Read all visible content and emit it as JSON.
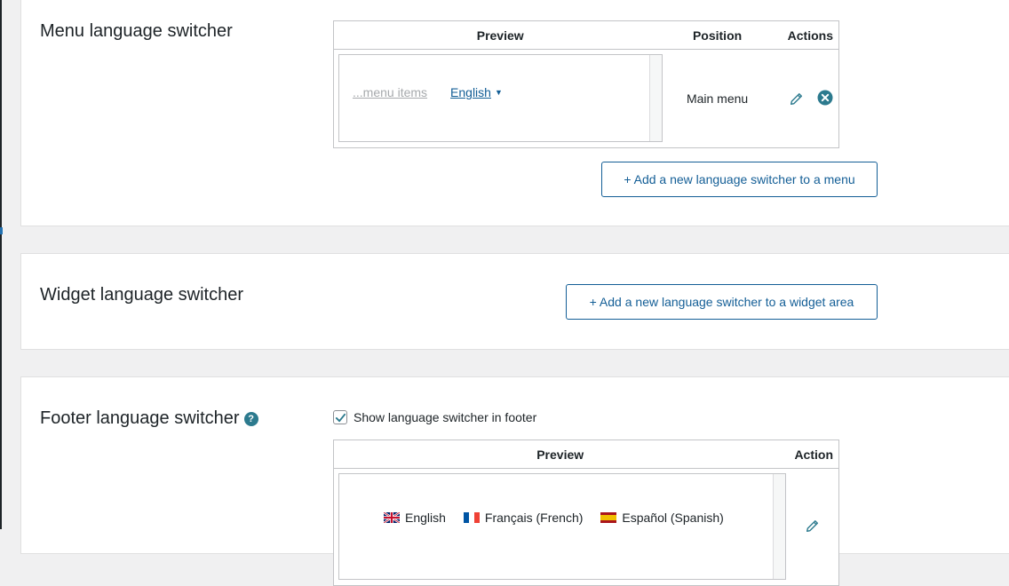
{
  "menu_section": {
    "title": "Menu language switcher",
    "table": {
      "headers": {
        "preview": "Preview",
        "position": "Position",
        "actions": "Actions"
      },
      "row": {
        "menu_items_label": "...menu items",
        "current_language": "English",
        "position": "Main menu"
      }
    },
    "add_button": "+ Add a new language switcher to a menu"
  },
  "widget_section": {
    "title": "Widget language switcher",
    "add_button": "+ Add a new language switcher to a widget area"
  },
  "footer_section": {
    "title": "Footer language switcher",
    "help_symbol": "?",
    "checkbox": {
      "label": "Show language switcher in footer",
      "checked": true
    },
    "table": {
      "headers": {
        "preview": "Preview",
        "action": "Action"
      },
      "languages": [
        {
          "label": "English",
          "flag": "gb-flag"
        },
        {
          "label": "Français (French)",
          "flag": "fr-flag"
        },
        {
          "label": "Español (Spanish)",
          "flag": "es-flag"
        }
      ]
    }
  },
  "colors": {
    "accent": "#135e96",
    "icon_teal": "#2c7a8e",
    "background": "#f0f0f1",
    "border": "#c3c4c7"
  },
  "icons": {
    "edit": "pencil-icon",
    "delete": "close-circle-icon",
    "help": "help-icon",
    "check": "checkmark-icon",
    "dropdown": "caret-down-icon"
  }
}
